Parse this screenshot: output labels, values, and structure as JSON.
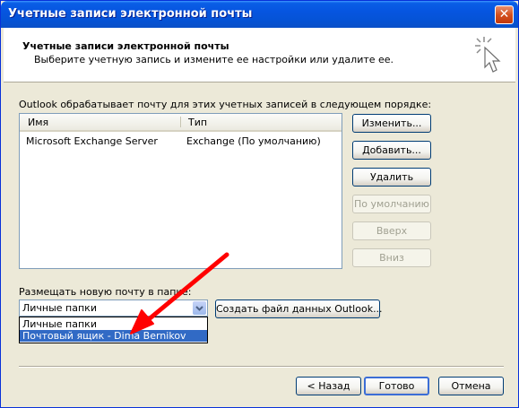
{
  "window": {
    "title": "Учетные записи электронной почты"
  },
  "header": {
    "title": "Учетные записи электронной почты",
    "subtitle": "Выберите учетную запись и измените ее настройки или удалите ее."
  },
  "accounts": {
    "label": "Outlook обрабатывает почту для этих учетных записей в следующем порядке:",
    "columns": [
      "Имя",
      "Тип"
    ],
    "rows": [
      {
        "name": "Microsoft Exchange Server",
        "type": "Exchange (По умолчанию)"
      }
    ]
  },
  "side_buttons": {
    "change": "Изменить...",
    "add": "Добавить...",
    "remove": "Удалить",
    "set_default": "По умолчанию",
    "up": "Вверх",
    "down": "Вниз"
  },
  "delivery": {
    "label": "Размещать новую почту в папке:",
    "selected": "Личные папки",
    "options": [
      "Личные папки",
      "Почтовый ящик - Dima Bernikov"
    ],
    "create_file_button": "Создать файл данных Outlook..."
  },
  "footer": {
    "back": "< Назад",
    "finish": "Готово",
    "cancel": "Отмена"
  },
  "colors": {
    "annotation_arrow": "#ff0000",
    "selection": "#316ac5"
  }
}
